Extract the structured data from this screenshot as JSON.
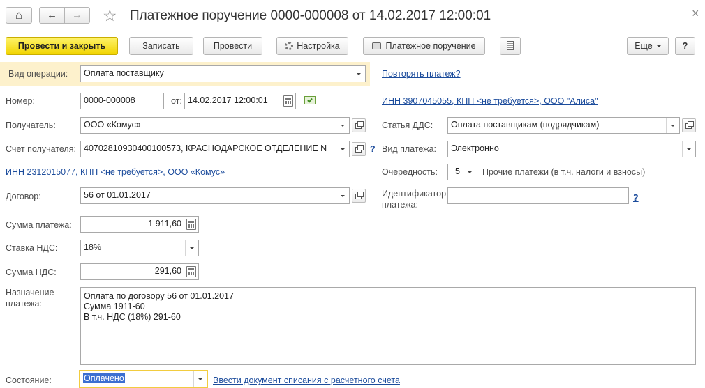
{
  "window": {
    "title": "Платежное поручение 0000-000008 от 14.02.2017 12:00:01",
    "close_glyph": "×",
    "star_glyph": "☆"
  },
  "nav": {
    "home_glyph": "⌂",
    "back_glyph": "←",
    "forward_glyph": "→"
  },
  "toolbar": {
    "post_close": "Провести и закрыть",
    "save": "Записать",
    "post": "Провести",
    "settings": "Настройка",
    "payment_order": "Платежное поручение",
    "more": "Еще",
    "help": "?"
  },
  "form": {
    "operation_type": {
      "label": "Вид операции:",
      "value": "Оплата поставщику"
    },
    "repeat_payment_link": "Повторять платеж?",
    "number": {
      "label": "Номер:",
      "value": "0000-000008"
    },
    "date": {
      "label": "от:",
      "value": "14.02.2017 12:00:01"
    },
    "payer_inn_link": "ИНН 3907045055, КПП <не требуется>, ООО \"Алиса\"",
    "recipient": {
      "label": "Получатель:",
      "value": "ООО  «Комус»"
    },
    "dds_article": {
      "label": "Статья ДДС:",
      "value": "Оплата поставщикам (подрядчикам)"
    },
    "recipient_account": {
      "label": "Счет получателя:",
      "value": "40702810930400100573, КРАСНОДАРСКОЕ ОТДЕЛЕНИЕ N"
    },
    "account_help": "?",
    "payment_kind": {
      "label": "Вид платежа:",
      "value": "Электронно"
    },
    "recipient_inn_link": "ИНН 2312015077, КПП <не требуется>, ООО  «Комус»",
    "priority": {
      "label": "Очередность:",
      "value": "5",
      "description": "Прочие платежи (в т.ч. налоги и взносы)"
    },
    "contract": {
      "label": "Договор:",
      "value": "56 от 01.01.2017"
    },
    "payment_id": {
      "label_line1": "Идентификатор",
      "label_line2": "платежа:",
      "value": "",
      "help": "?"
    },
    "payment_sum": {
      "label": "Сумма платежа:",
      "value": "1 911,60"
    },
    "vat_rate": {
      "label": "Ставка НДС:",
      "value": "18%"
    },
    "vat_sum": {
      "label": "Сумма НДС:",
      "value": "291,60"
    },
    "purpose": {
      "label_line1": "Назначение",
      "label_line2": "платежа:",
      "lines": [
        "Оплата по договору 56 от 01.01.2017",
        "Сумма 1911-60",
        "В т.ч. НДС  (18%) 291-60"
      ]
    },
    "status": {
      "label": "Состояние:",
      "value": "Оплачено"
    },
    "write_off_link": "Ввести документ списания с расчетного счета"
  },
  "colors": {
    "primary_button": "#f1d400",
    "highlight_row": "#fdf1cc",
    "link": "#1c4c9c",
    "selection": "#3c6fd1"
  }
}
